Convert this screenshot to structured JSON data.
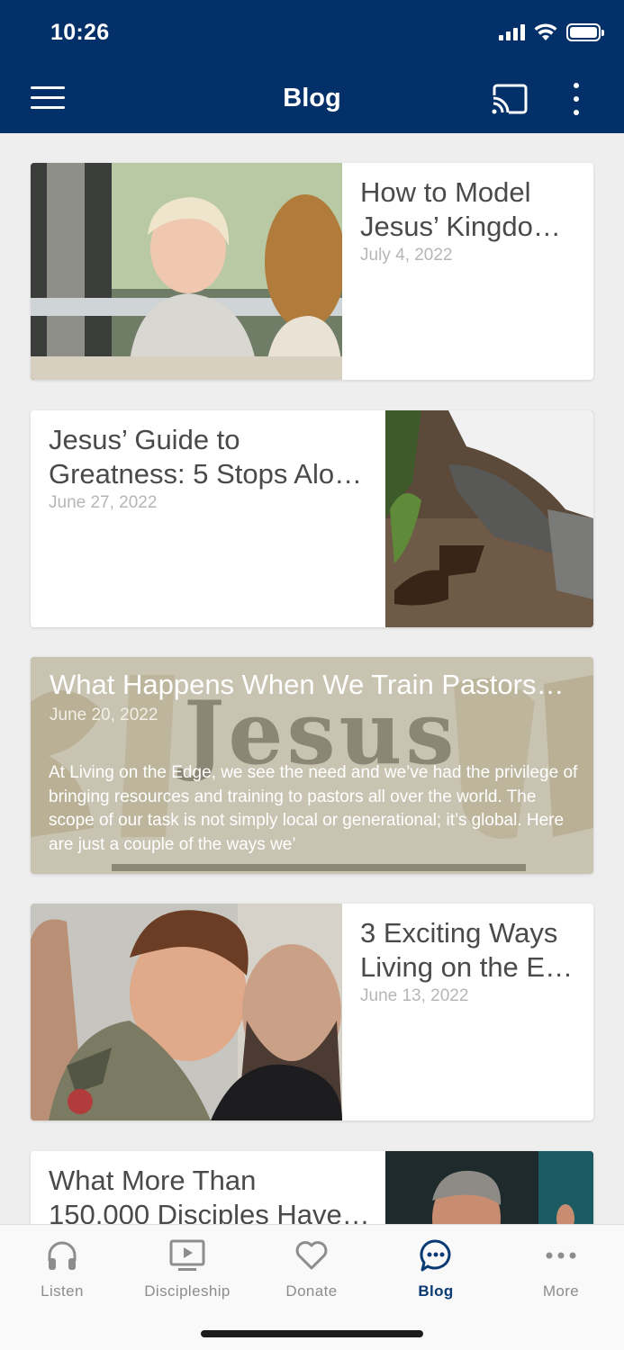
{
  "status_bar": {
    "time": "10:26"
  },
  "header": {
    "title": "Blog",
    "menu_icon": "hamburger-icon",
    "cast_icon": "cast-icon",
    "more_icon": "kebab-icon",
    "bg_color": "#033068"
  },
  "posts": [
    {
      "title_line1": "How to Model",
      "title_line2": "Jesus’ Kingdo…",
      "date": "July 4, 2022"
    },
    {
      "title_line1": "Jesus’ Guide to",
      "title_line2": "Greatness: 5 Stops Alo…",
      "date": "June 27, 2022"
    },
    {
      "title": "What Happens When We Train Pastors…",
      "date": "June 20, 2022",
      "bg_word": "Jesus",
      "excerpt": "At Living on the Edge, we see the need and we’ve had the privilege of bringing resources and training to pastors all over the world. The scope of our task is not simply local or generational; it’s global. Here are just a couple of the ways we’"
    },
    {
      "title_line1": "3 Exciting Ways",
      "title_line2": "Living on the E…",
      "date": "June 13, 2022"
    },
    {
      "title_line1": "What More Than",
      "title_line2": "150,000 Disciples Have…"
    }
  ],
  "bottom_nav": [
    {
      "label": "Listen",
      "icon": "headphones-icon"
    },
    {
      "label": "Discipleship",
      "icon": "video-screen-icon"
    },
    {
      "label": "Donate",
      "icon": "heart-icon"
    },
    {
      "label": "Blog",
      "icon": "chat-bubble-icon",
      "active": true
    },
    {
      "label": "More",
      "icon": "ellipsis-icon"
    }
  ],
  "colors": {
    "accent": "#0a3a74",
    "inactive": "#8d8d8d"
  }
}
